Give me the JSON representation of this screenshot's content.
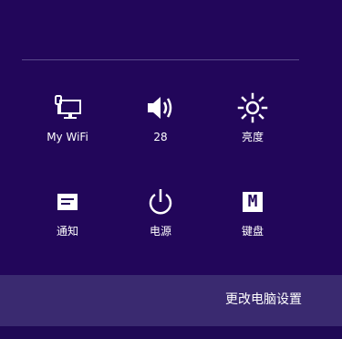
{
  "quick_settings": {
    "network": {
      "label": "My WiFi",
      "icon": "monitor-network-icon"
    },
    "volume": {
      "label": "28",
      "icon": "speaker-icon"
    },
    "brightness": {
      "label": "亮度",
      "icon": "brightness-sun-icon"
    },
    "notifications": {
      "label": "通知",
      "icon": "notification-icon"
    },
    "power": {
      "label": "电源",
      "icon": "power-icon"
    },
    "keyboard": {
      "label": "键盘",
      "icon": "keyboard-icon",
      "glyph": "M"
    }
  },
  "settings_bar": {
    "link_label": "更改电脑设置"
  },
  "colors": {
    "background": "#22065a",
    "bar": "#3a2a70",
    "text": "#ffffff"
  }
}
